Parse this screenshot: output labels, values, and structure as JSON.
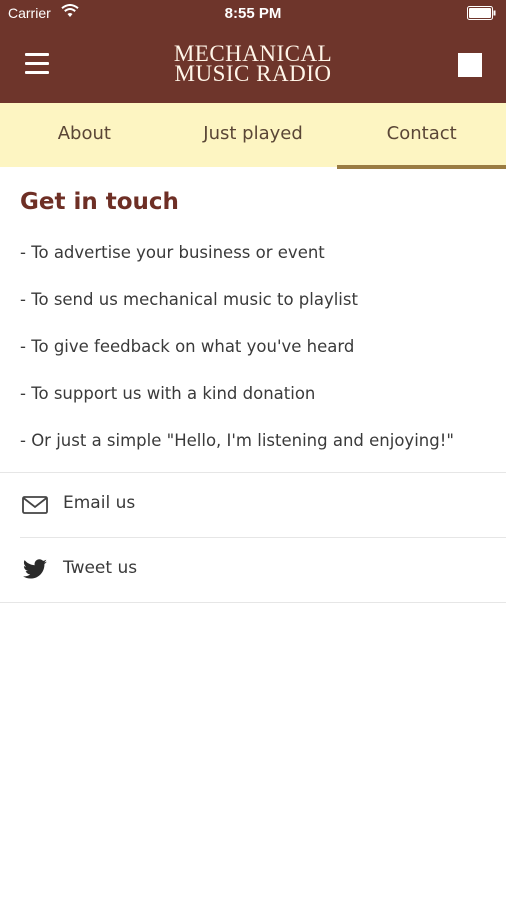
{
  "status_bar": {
    "carrier": "Carrier",
    "time": "8:55 PM"
  },
  "header": {
    "title_line1": "MECHANICAL",
    "title_line2": "MUSIC RADIO",
    "menu_icon": "hamburger-icon",
    "stop_icon": "stop-icon"
  },
  "tabs": [
    {
      "label": "About",
      "active": false
    },
    {
      "label": "Just played",
      "active": false
    },
    {
      "label": "Contact",
      "active": true
    }
  ],
  "contact": {
    "heading": "Get in touch",
    "bullets": [
      "- To advertise your business or event",
      "- To send us mechanical music to playlist",
      "- To give feedback on what you've heard",
      "- To support us with a kind donation",
      "- Or just a simple \"Hello, I'm listening and enjoying!\""
    ],
    "actions": [
      {
        "label": "Email us",
        "icon": "envelope-icon"
      },
      {
        "label": "Tweet us",
        "icon": "twitter-icon"
      }
    ]
  },
  "colors": {
    "header_bg": "#6e352b",
    "tab_bg": "#fdf5c2",
    "tab_indicator": "#9a7c42",
    "heading": "#6e2f25"
  }
}
